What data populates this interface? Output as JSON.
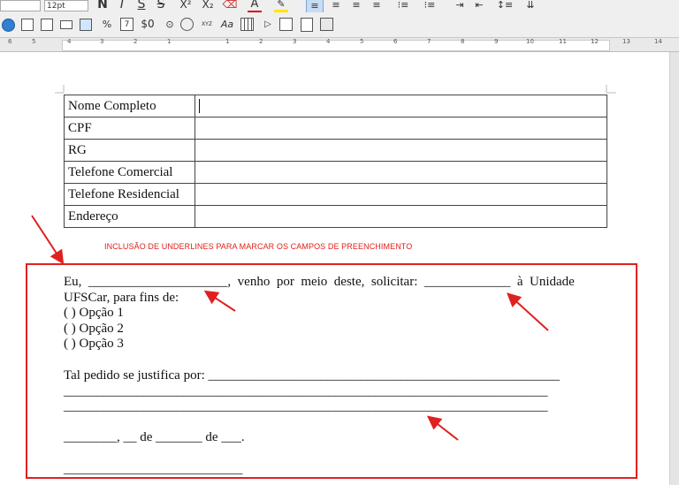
{
  "toolbar": {
    "font_size": "12pt",
    "bold": "N",
    "italic": "I",
    "underline": "S",
    "strikethrough": "S",
    "superscript": "X²",
    "subscript": "X₂",
    "font_color": "A",
    "currency": "$0",
    "char_format": "Aa"
  },
  "ruler": {
    "ticks": [
      "6",
      "5",
      "4",
      "3",
      "2",
      "1",
      "1",
      "2",
      "3",
      "4",
      "5",
      "6",
      "7",
      "8",
      "9",
      "10",
      "11",
      "12",
      "13",
      "14"
    ]
  },
  "form_table": {
    "rows": [
      {
        "label": "Nome Completo",
        "value": ""
      },
      {
        "label": "CPF",
        "value": ""
      },
      {
        "label": "RG",
        "value": ""
      },
      {
        "label": "Telefone Comercial",
        "value": ""
      },
      {
        "label": "Telefone Residencial",
        "value": ""
      },
      {
        "label": "Endereço",
        "value": ""
      }
    ]
  },
  "annotation_note": "INCLUSÃO DE UNDERLINES PARA MARCAR OS CAMPOS DE PREENCHIMENTO",
  "document": {
    "line1": "Eu,  _____________________,  venho  por  meio  deste,  solicitar:  _____________  à  Unidade",
    "line2": "UFSCar, para fins de:",
    "option1": "( ) Opção 1",
    "option2": "( ) Opção 2",
    "option3": "( ) Opção 3",
    "justify_line": "Tal pedido se justifica por: _____________________________________________________",
    "blank_line1": "_________________________________________________________________________",
    "blank_line2": "_________________________________________________________________________",
    "date_line": "________, __ de _______ de ___.",
    "signature_line": "___________________________"
  },
  "colors": {
    "annotation_red": "#e02020"
  }
}
